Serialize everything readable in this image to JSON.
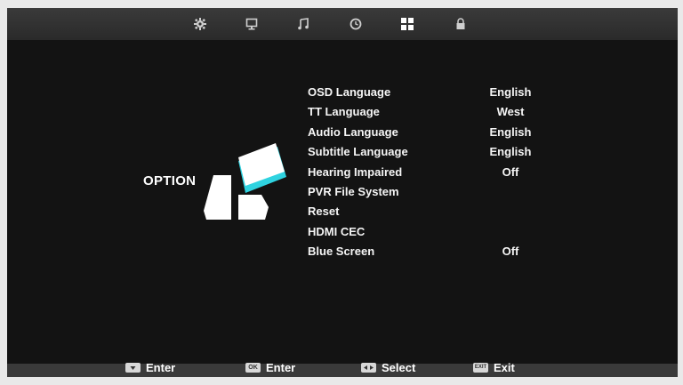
{
  "tabs": [
    {
      "icon": "gear-icon"
    },
    {
      "icon": "monitor-icon"
    },
    {
      "icon": "music-note-icon"
    },
    {
      "icon": "clock-icon"
    },
    {
      "icon": "option-grid-icon",
      "selected": true
    },
    {
      "icon": "lock-icon"
    }
  ],
  "menu": {
    "title": "OPTION",
    "items": [
      {
        "label": "OSD Language",
        "value": "English"
      },
      {
        "label": "TT Language",
        "value": "West"
      },
      {
        "label": "Audio Language",
        "value": "English"
      },
      {
        "label": "Subtitle Language",
        "value": "English"
      },
      {
        "label": "Hearing Impaired",
        "value": "Off"
      },
      {
        "label": "PVR File System",
        "value": ""
      },
      {
        "label": "Reset",
        "value": ""
      },
      {
        "label": "HDMI CEC",
        "value": ""
      },
      {
        "label": "Blue Screen",
        "value": "Off"
      }
    ]
  },
  "footer": {
    "hints": [
      {
        "key": "down-arrow-key-icon",
        "label": "Enter"
      },
      {
        "key": "ok-key-icon",
        "key_text": "OK",
        "label": "Enter"
      },
      {
        "key": "left-right-key-icon",
        "label": "Select"
      },
      {
        "key": "exit-key-icon",
        "key_text": "EXIT",
        "label": "Exit"
      }
    ]
  },
  "colors": {
    "accent": "#2fd3e0",
    "background": "#131313",
    "text": "#f5f5f5"
  }
}
